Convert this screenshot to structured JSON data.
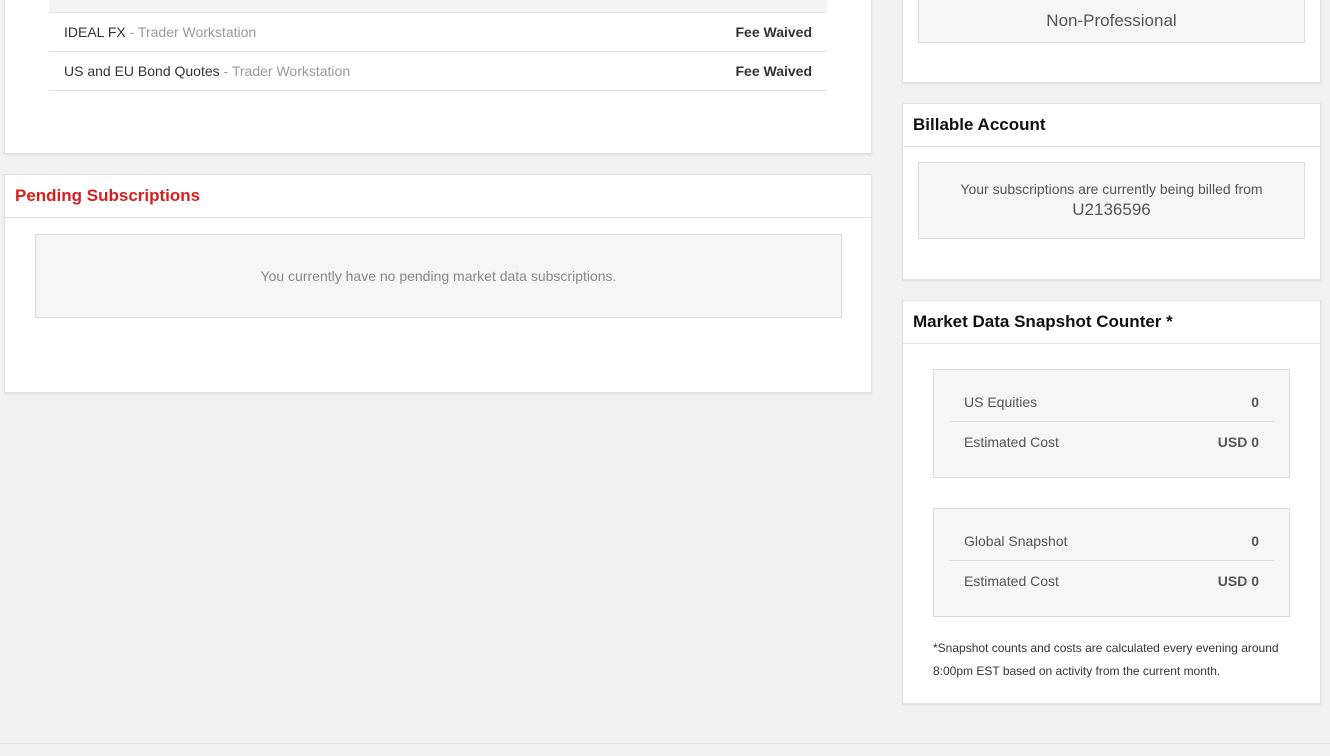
{
  "subscriptions": [
    {
      "name": "IDEAL FX",
      "platform": " - Trader Workstation",
      "fee": "Fee Waived"
    },
    {
      "name": "US and EU Bond Quotes",
      "platform": " - Trader Workstation",
      "fee": "Fee Waived"
    }
  ],
  "pending": {
    "title": "Pending Subscriptions",
    "empty_message": "You currently have no pending market data subscriptions."
  },
  "subscriber_status": {
    "value": "Non-Professional"
  },
  "billable": {
    "title": "Billable Account",
    "message": "Your subscriptions are currently being billed from",
    "account": "U2136596"
  },
  "snapshot": {
    "title": "Market Data Snapshot Counter *",
    "groups": [
      {
        "label": "US Equities",
        "count": "0",
        "cost_label": "Estimated Cost",
        "cost": "USD 0"
      },
      {
        "label": "Global Snapshot",
        "count": "0",
        "cost_label": "Estimated Cost",
        "cost": "USD 0"
      }
    ],
    "footnote": "*Snapshot counts and costs are calculated every evening around 8:00pm EST based on activity from the current month."
  },
  "colors": {
    "accent_red": "#d81e1e",
    "background": "#f2f2f2"
  }
}
